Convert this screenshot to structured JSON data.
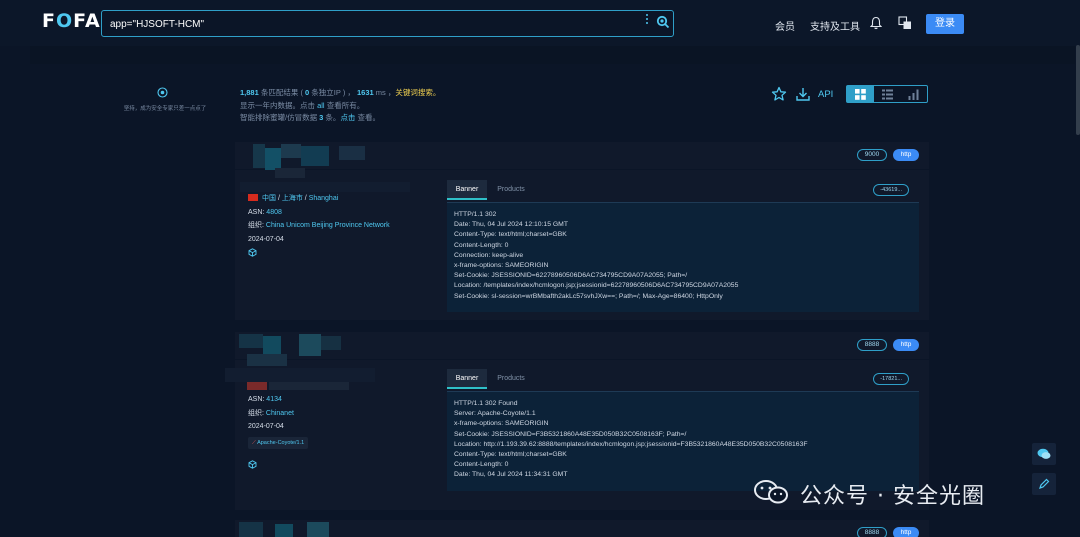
{
  "header": {
    "logo_f": "F",
    "logo_o": "O",
    "logo_fa": "FA",
    "search_value": "app=\"HJSOFT-HCM\"",
    "nav": [
      "会员",
      "支持及工具"
    ],
    "login_label": "登录"
  },
  "left_panel": {
    "tip": "坚持，成为安全专家只差一点点了"
  },
  "summary": {
    "count": "1,881",
    "t1": " 条匹配结果 ( ",
    "ip_count": "0",
    "t2": " 条独立IP ) ， ",
    "ms": "1631",
    "t3": " ms ，",
    "keyword_search": "关键词搜索。",
    "line2_a": "显示一年内数据。点击 ",
    "line2_all": "all",
    "line2_b": " 查看所有。",
    "line3_a": "智能排除蜜罐/仿冒数据 ",
    "line3_n": "3",
    "line3_b": " 条。",
    "line3_click": "点击",
    "line3_c": " 查看。"
  },
  "toolbar": {
    "api_label": "API"
  },
  "results": [
    {
      "port": "9000",
      "protocol": "http",
      "country": "中国",
      "region": "上海市",
      "city": "Shanghai",
      "asn_label": "ASN: ",
      "asn": "4808",
      "org_label": "组织: ",
      "org": "China Unicom Beijing Province Network",
      "date": "2024-07-04",
      "tab_banner": "Banner",
      "tab_products": "Products",
      "hash": "-43619...",
      "banner": "HTTP/1.1 302\nDate: Thu, 04 Jul 2024 12:10:15 GMT\nContent-Type: text/html;charset=GBK\nContent-Length: 0\nConnection: keep-alive\nx-frame-options: SAMEORIGIN\nSet-Cookie: JSESSIONID=62278960506D6AC734795CD9A07A2055; Path=/\nLocation: /templates/index/hcmlogon.jsp;jsessionid=62278960506D6AC734795CD9A07A2055\nSet-Cookie: sl-session=wrBMbafth2akLc57svhJXw==; Path=/; Max-Age=86400; HttpOnly"
    },
    {
      "port": "8888",
      "protocol": "http",
      "asn_label": "ASN: ",
      "asn": "4134",
      "org_label": "组织: ",
      "org": "Chinanet",
      "date": "2024-07-04",
      "tech": "Apache-Coyote/1.1",
      "tab_banner": "Banner",
      "tab_products": "Products",
      "hash": "-17821...",
      "banner": "HTTP/1.1 302 Found\nServer: Apache-Coyote/1.1\nx-frame-options: SAMEORIGIN\nSet-Cookie: JSESSIONID=F3B5321860A48E35D050B32C0508163F; Path=/\nLocation: http://1.193.39.62:8888/templates/index/hcmlogon.jsp;jsessionid=F3B5321860A48E35D050B32C0508163F\nContent-Type: text/html;charset=GBK\nContent-Length: 0\nDate: Thu, 04 Jul 2024 11:34:31 GMT"
    },
    {
      "port": "8888",
      "protocol": "http"
    }
  ],
  "watermark": "公众号 · 安全光圈",
  "colors": {
    "background": "#0b1527",
    "card": "#10192b",
    "accent": "#4fc8f0",
    "primary_button": "#3b8bf5",
    "highlight": "#f0d050"
  }
}
